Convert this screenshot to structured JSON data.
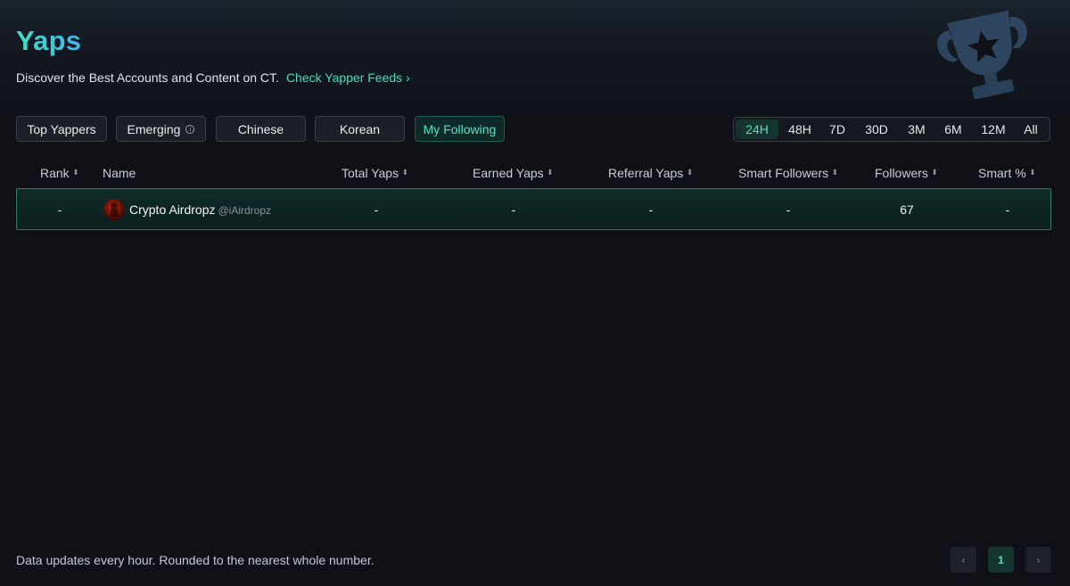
{
  "header": {
    "title": "Yaps",
    "subtitle": "Discover the Best Accounts and Content on CT.",
    "feeds_link": "Check Yapper Feeds",
    "feeds_chevron": "›"
  },
  "tabs": [
    {
      "label": "Top Yappers",
      "active": false
    },
    {
      "label": "Emerging",
      "active": false,
      "info": "i"
    },
    {
      "label": "Chinese",
      "active": false
    },
    {
      "label": "Korean",
      "active": false
    },
    {
      "label": "My Following",
      "active": true
    }
  ],
  "periods": [
    {
      "label": "24H",
      "active": true
    },
    {
      "label": "48H",
      "active": false
    },
    {
      "label": "7D",
      "active": false
    },
    {
      "label": "30D",
      "active": false
    },
    {
      "label": "3M",
      "active": false
    },
    {
      "label": "6M",
      "active": false
    },
    {
      "label": "12M",
      "active": false
    },
    {
      "label": "All",
      "active": false
    }
  ],
  "table": {
    "columns": [
      "Rank",
      "Name",
      "Total Yaps",
      "Earned Yaps",
      "Referral Yaps",
      "Smart Followers",
      "Followers",
      "Smart %"
    ],
    "sort_icon": "⬍",
    "rows": [
      {
        "rank": "-",
        "name": "Crypto Airdropz",
        "handle": "@iAirdropz",
        "total_yaps": "-",
        "earned_yaps": "-",
        "referral_yaps": "-",
        "smart_followers": "-",
        "followers": "67",
        "smart_pct": "-"
      }
    ]
  },
  "footer": {
    "note": "Data updates every hour. Rounded to the nearest whole number.",
    "prev": "‹",
    "page": "1",
    "next": "›"
  },
  "colors": {
    "accent": "#3ee0c0",
    "background": "#0f1116",
    "active_tab_bg": "#0f2a26"
  }
}
